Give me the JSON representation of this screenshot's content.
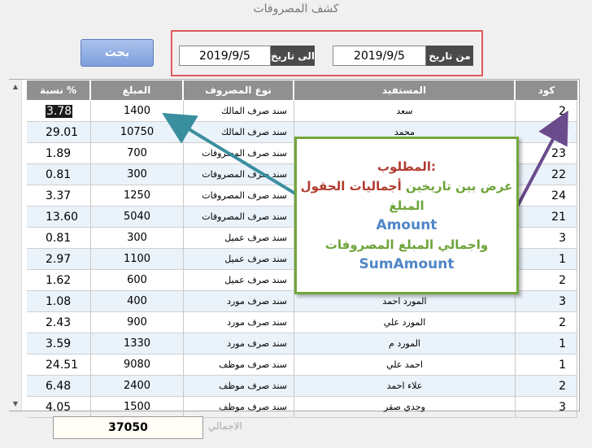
{
  "window": {
    "title": "كشف المصروفات"
  },
  "toolbar": {
    "search_label": "بحث"
  },
  "date_range": {
    "from_label": "من تاريخ",
    "from_value": "2019/9/5",
    "to_label": "الى تاريخ",
    "to_value": "2019/9/5"
  },
  "table": {
    "headers": {
      "percent": "نسبة %",
      "amount": "المبلغ",
      "type": "نوع المصروف",
      "beneficiary": "المستفيد",
      "code": "كود"
    },
    "rows": [
      {
        "percent": "3.78",
        "amount": "1400",
        "type": "سند صرف المالك",
        "beneficiary": "سعد",
        "code": "2"
      },
      {
        "percent": "29.01",
        "amount": "10750",
        "type": "سند صرف المالك",
        "beneficiary": "محمد",
        "code": "1"
      },
      {
        "percent": "1.89",
        "amount": "700",
        "type": "سند صرف المصروفات",
        "beneficiary": "",
        "code": "23"
      },
      {
        "percent": "0.81",
        "amount": "300",
        "type": "سند صرف المصروفات",
        "beneficiary": "",
        "code": "22"
      },
      {
        "percent": "3.37",
        "amount": "1250",
        "type": "سند صرف المصروفات",
        "beneficiary": "",
        "code": "24"
      },
      {
        "percent": "13.60",
        "amount": "5040",
        "type": "سند صرف المصروفات",
        "beneficiary": "",
        "code": "21"
      },
      {
        "percent": "0.81",
        "amount": "300",
        "type": "سند صرف عميل",
        "beneficiary": "",
        "code": "3"
      },
      {
        "percent": "2.97",
        "amount": "1100",
        "type": "سند صرف عميل",
        "beneficiary": "",
        "code": "1"
      },
      {
        "percent": "1.62",
        "amount": "600",
        "type": "سند صرف عميل",
        "beneficiary": "",
        "code": "2"
      },
      {
        "percent": "1.08",
        "amount": "400",
        "type": "سند صرف مورد",
        "beneficiary": "المورد احمد",
        "code": "3"
      },
      {
        "percent": "2.43",
        "amount": "900",
        "type": "سند صرف مورد",
        "beneficiary": "المورد علي",
        "code": "2"
      },
      {
        "percent": "3.59",
        "amount": "1330",
        "type": "سند صرف مورد",
        "beneficiary": "المورد م",
        "code": "1"
      },
      {
        "percent": "24.51",
        "amount": "9080",
        "type": "سند صرف موظف",
        "beneficiary": "احمد علي",
        "code": "1"
      },
      {
        "percent": "6.48",
        "amount": "2400",
        "type": "سند صرف موظف",
        "beneficiary": "علاء احمد",
        "code": "2"
      },
      {
        "percent": "4.05",
        "amount": "1500",
        "type": "سند صرف موظف",
        "beneficiary": "وجدي صقر",
        "code": "3"
      }
    ]
  },
  "total": {
    "label": "الاجمالي",
    "value": "37050"
  },
  "annotation": {
    "line1": "المطلوب:",
    "line2": "عرض بين تاريخين أجماليات الحقول",
    "line3": "المبلغ",
    "line4": "Amount",
    "line5": "واجمالي المبلغ المصروفات",
    "line6": "SumAmount"
  },
  "colors": {
    "accent_red": "#e05a5a",
    "note_border": "#71a63a",
    "note_title": "#b23b2e",
    "note_green": "#6ea43a",
    "note_blue": "#4f86c6",
    "arrow_teal": "#3a8f9f",
    "arrow_purple": "#6a4b8c"
  }
}
